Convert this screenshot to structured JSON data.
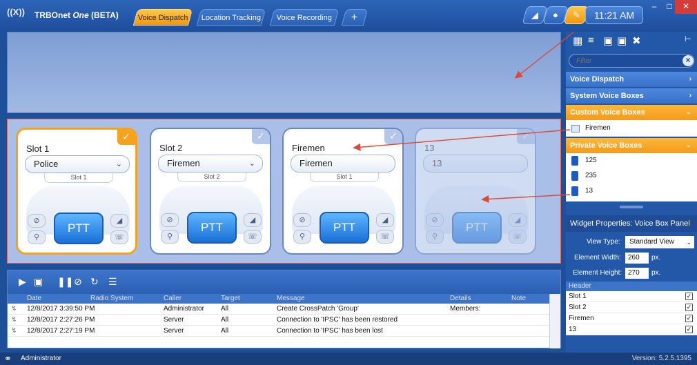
{
  "titlebar": {
    "app_name": "TRBOnet",
    "app_name_italic": "One",
    "app_name_suffix": "(BETA)",
    "tabs": [
      {
        "label": "Voice Dispatch",
        "active": true
      },
      {
        "label": "Location Tracking",
        "active": false
      },
      {
        "label": "Voice Recording",
        "active": false
      }
    ],
    "add_tab": "+",
    "clock": "11:21 AM"
  },
  "voice_boxes": [
    {
      "title": "Slot 1",
      "channel": "Police",
      "slot": "Slot 1",
      "ptt": "PTT",
      "selected": true
    },
    {
      "title": "Slot 2",
      "channel": "Firemen",
      "slot": "Slot 2",
      "ptt": "PTT",
      "selected": false
    },
    {
      "title": "Firemen",
      "channel": "Firemen",
      "slot": "Slot 1",
      "ptt": "PTT",
      "selected": false
    },
    {
      "title": "13",
      "channel": "13",
      "slot": "",
      "ptt": "PTT",
      "selected": false
    }
  ],
  "log": {
    "columns": [
      "Date",
      "Radio System",
      "Caller",
      "Target",
      "Message",
      "Details",
      "Note"
    ],
    "rows": [
      {
        "date": "12/8/2017 3:39:50 PM",
        "radio_system": "",
        "caller": "Administrator",
        "target": "All",
        "message": "Create CrossPatch 'Group'",
        "details": "Members:",
        "note": ""
      },
      {
        "date": "12/8/2017 2:27:26 PM",
        "radio_system": "",
        "caller": "Server",
        "target": "All",
        "message": "Connection to 'IPSC' has been restored",
        "details": "",
        "note": ""
      },
      {
        "date": "12/8/2017 2:27:19 PM",
        "radio_system": "",
        "caller": "Server",
        "target": "All",
        "message": "Connection to 'IPSC' has been lost",
        "details": "",
        "note": ""
      }
    ]
  },
  "status": {
    "user": "Administrator",
    "version": "Version: 5.2.5.1395"
  },
  "right_panel": {
    "filter_placeholder": "Filter",
    "sections": {
      "voice_dispatch": "Voice Dispatch",
      "system_voice_boxes": "System Voice Boxes",
      "custom_voice_boxes": "Custom Voice Boxes",
      "private_voice_boxes": "Private Voice Boxes"
    },
    "custom_items": [
      "Firemen"
    ],
    "private_items": [
      "125",
      "235",
      "13"
    ],
    "widget_properties_title": "Widget Properties: Voice Box Panel",
    "view_type_label": "View Type:",
    "view_type_value": "Standard View",
    "element_width_label": "Element Width:",
    "element_width_value": "260",
    "element_height_label": "Element Height:",
    "element_height_value": "270",
    "unit": "px.",
    "header_col": "Header",
    "headers": [
      {
        "label": "Slot 1",
        "checked": true
      },
      {
        "label": "Slot 2",
        "checked": true
      },
      {
        "label": "Firemen",
        "checked": true
      },
      {
        "label": "13",
        "checked": true
      }
    ]
  },
  "colors": {
    "accent_orange": "#f5a21e",
    "primary_blue": "#2357a8",
    "annotation_red": "#d94a3a"
  }
}
